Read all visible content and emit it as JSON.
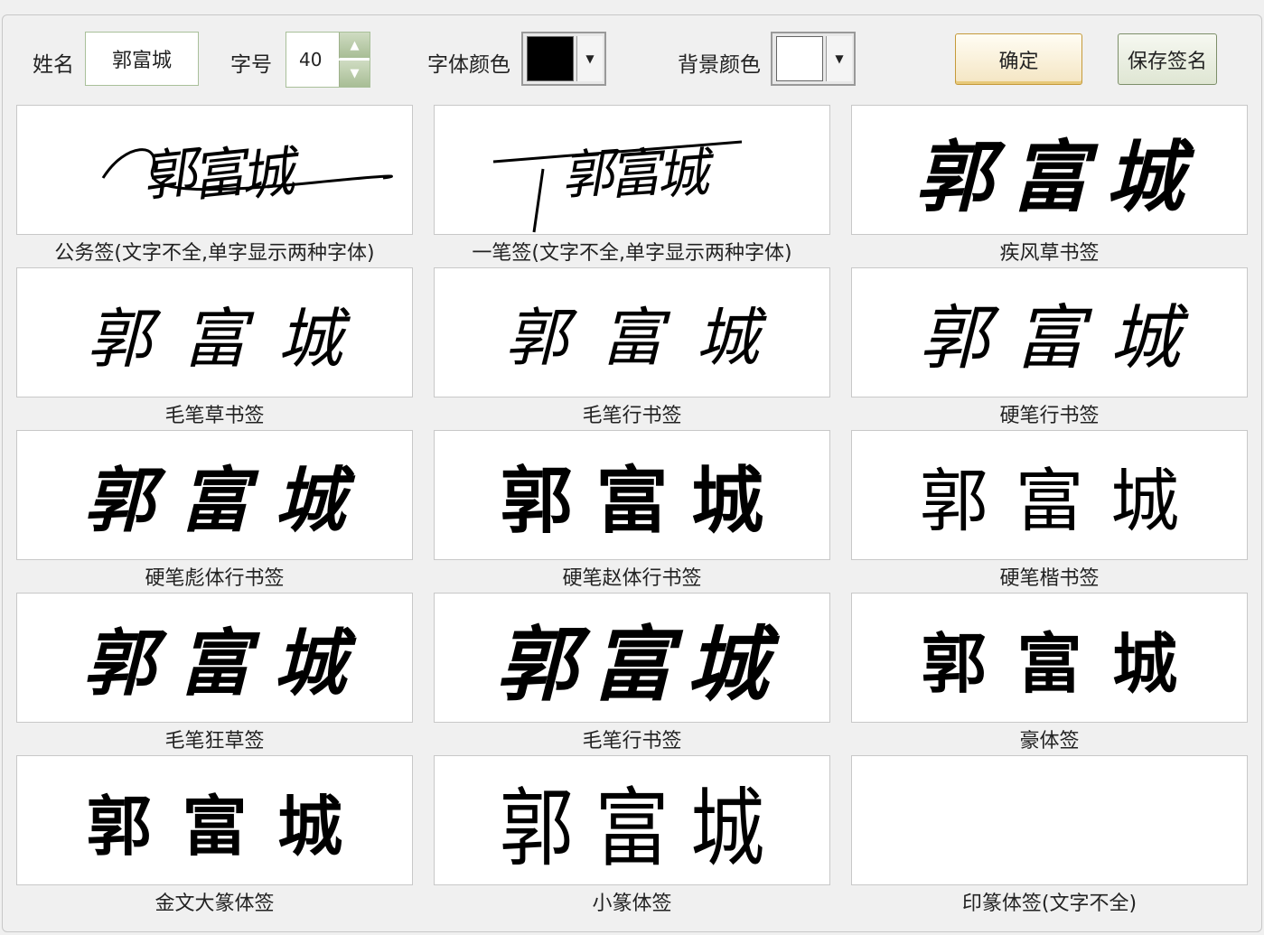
{
  "toolbar": {
    "name_label": "姓名",
    "name_value": "郭富城",
    "size_label": "字号",
    "size_value": "40",
    "font_color_label": "字体颜色",
    "font_color": "#000000",
    "bg_color_label": "背景颜色",
    "bg_color": "#ffffff",
    "confirm_label": "确定",
    "save_label": "保存签名"
  },
  "signature_text": "郭富城",
  "styles": [
    {
      "caption": "公务签(文字不全,单字显示两种字体)",
      "rendered": "郭富城"
    },
    {
      "caption": "一笔签(文字不全,单字显示两种字体)",
      "rendered": "郭富城"
    },
    {
      "caption": "疾风草书签",
      "rendered": "郭富城"
    },
    {
      "caption": "毛笔草书签",
      "rendered": "郭富城"
    },
    {
      "caption": "毛笔行书签",
      "rendered": "郭富城"
    },
    {
      "caption": "硬笔行书签",
      "rendered": "郭富城"
    },
    {
      "caption": "硬笔彪体行书签",
      "rendered": "郭富城"
    },
    {
      "caption": "硬笔赵体行书签",
      "rendered": "郭富城"
    },
    {
      "caption": "硬笔楷书签",
      "rendered": "郭富城"
    },
    {
      "caption": "毛笔狂草签",
      "rendered": "郭富城"
    },
    {
      "caption": "毛笔行书签",
      "rendered": "郭富城"
    },
    {
      "caption": "豪体签",
      "rendered": "郭富城"
    },
    {
      "caption": "金文大篆体签",
      "rendered": "郭富城"
    },
    {
      "caption": "小篆体签",
      "rendered": "郭富城"
    },
    {
      "caption": "印篆体签(文字不全)",
      "rendered": ""
    }
  ]
}
